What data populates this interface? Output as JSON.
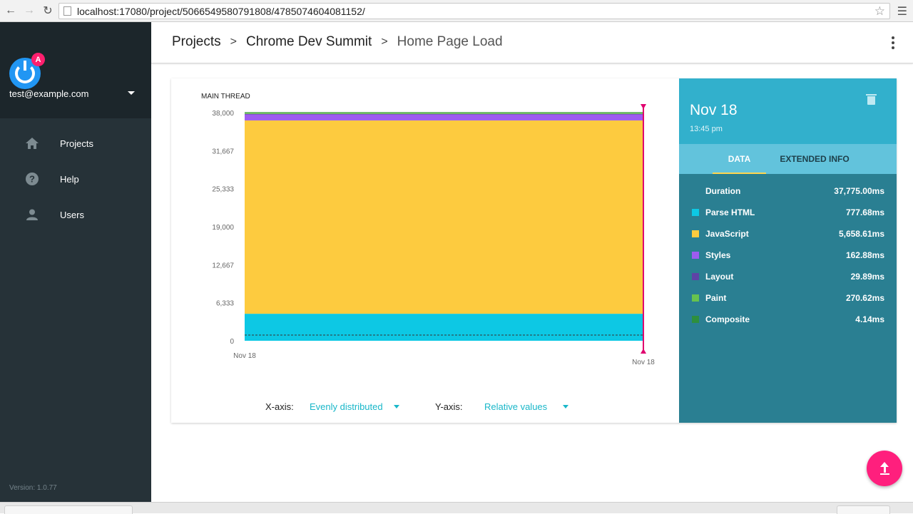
{
  "browser": {
    "url": "localhost:17080/project/5066549580791808/4785074604081152/",
    "back_icon": "arrow-back-icon",
    "forward_icon": "arrow-forward-icon",
    "reload_icon": "reload-icon"
  },
  "sidebar": {
    "user_email": "test@example.com",
    "logo_badge": "A",
    "items": [
      {
        "label": "Projects",
        "icon": "home-icon"
      },
      {
        "label": "Help",
        "icon": "help-icon"
      },
      {
        "label": "Users",
        "icon": "person-icon"
      }
    ],
    "version": "Version: 1.0.77"
  },
  "header": {
    "breadcrumb": [
      "Projects",
      "Chrome Dev Summit",
      "Home Page Load"
    ],
    "separator": ">"
  },
  "chart": {
    "axis_controls": {
      "x_label": "X-axis:",
      "x_value": "Evenly distributed",
      "y_label": "Y-axis:",
      "y_value": "Relative values"
    }
  },
  "chart_data": {
    "type": "area",
    "title": "MAIN THREAD",
    "x": [
      "Nov 18",
      "Nov 18"
    ],
    "y_ticks": [
      "0",
      "6,333",
      "12,667",
      "19,000",
      "25,333",
      "31,667",
      "38,000"
    ],
    "ylim": [
      0,
      38000
    ],
    "series": [
      {
        "name": "Parse HTML",
        "color": "#0dc8e4",
        "values": [
          4500,
          4500
        ]
      },
      {
        "name": "JavaScript",
        "color": "#fdcb3f",
        "values": [
          32200,
          32200
        ]
      },
      {
        "name": "Styles",
        "color": "#9d5cf0",
        "values": [
          1000,
          1000
        ]
      },
      {
        "name": "Layout",
        "color": "#5e43a6",
        "values": [
          100,
          100
        ]
      },
      {
        "name": "Paint",
        "color": "#67c34e",
        "values": [
          200,
          200
        ]
      },
      {
        "name": "Composite",
        "color": "#2e8f3d",
        "values": [
          75,
          75
        ]
      }
    ],
    "dashed_line_value": 950,
    "marker_color": "#e0006e"
  },
  "detail": {
    "date": "Nov 18",
    "time": "13:45 pm",
    "tabs": [
      "DATA",
      "EXTENDED INFO"
    ],
    "active_tab": "DATA",
    "rows": [
      {
        "name": "Duration",
        "value": "37,775.00ms",
        "color": ""
      },
      {
        "name": "Parse HTML",
        "value": "777.68ms",
        "color": "#0dc8e4"
      },
      {
        "name": "JavaScript",
        "value": "5,658.61ms",
        "color": "#fdcb3f"
      },
      {
        "name": "Styles",
        "value": "162.88ms",
        "color": "#9d5cf0"
      },
      {
        "name": "Layout",
        "value": "29.89ms",
        "color": "#5e43a6"
      },
      {
        "name": "Paint",
        "value": "270.62ms",
        "color": "#67c34e"
      },
      {
        "name": "Composite",
        "value": "4.14ms",
        "color": "#2e8f3d"
      }
    ]
  },
  "fab": {
    "icon": "upload-icon"
  }
}
